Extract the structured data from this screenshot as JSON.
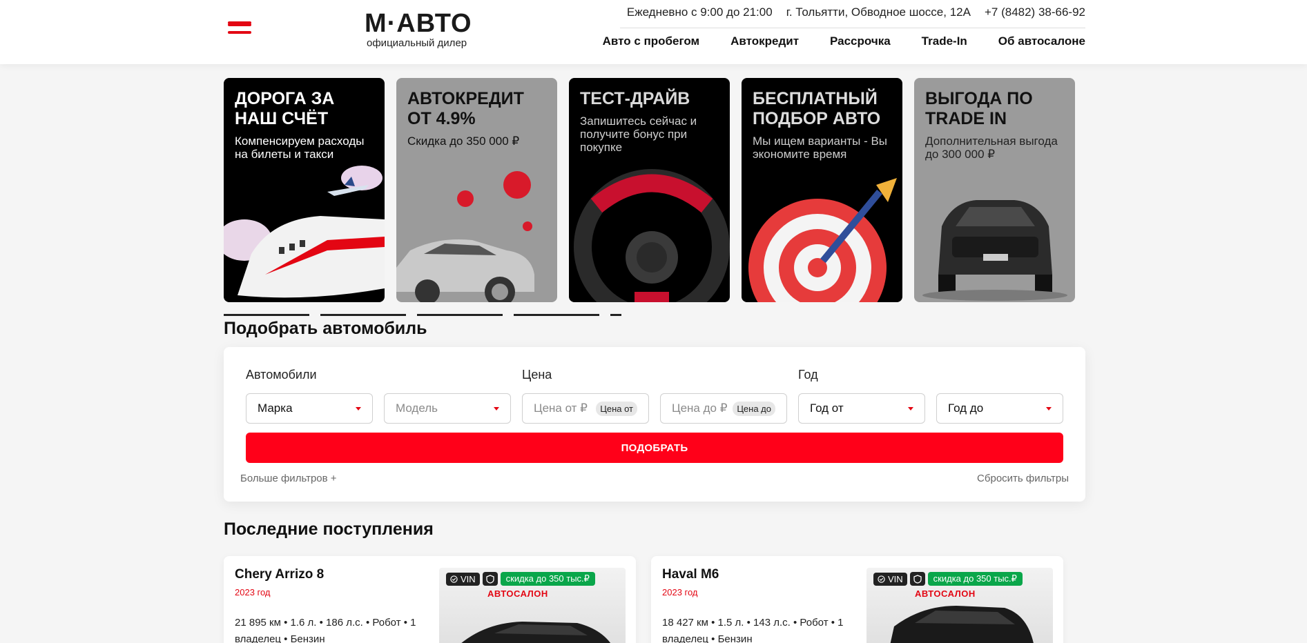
{
  "header": {
    "logo_main": "М·АВТО",
    "logo_sub": "официальный дилер",
    "hours": "Ежедневно с 9:00 до 21:00",
    "address": "г. Тольятти, Обводное шоссе, 12А",
    "phone": "+7 (8482) 38-66-92",
    "nav": [
      "Авто с пробегом",
      "Автокредит",
      "Рассрочка",
      "Trade-In",
      "Об автосалоне"
    ]
  },
  "banners": [
    {
      "title": "ДОРОГА ЗА НАШ СЧЁТ",
      "text": "Компенсируем расходы на билеты и такси",
      "art": "train-plane"
    },
    {
      "title": "АВТОКРЕДИТ ОТ 4.9%",
      "text": "Скидка до 350 000 ₽",
      "art": "car-coins"
    },
    {
      "title": "ТЕСТ-ДРАЙВ",
      "text": "Запишитесь сейчас и получите бонус при покупке",
      "art": "steering-wheel"
    },
    {
      "title": "БЕСПЛАТНЫЙ ПОДБОР АВТО",
      "text": "Мы ищем варианты - Вы экономите время",
      "art": "target-dart"
    },
    {
      "title": "ВЫГОДА ПО TRADE IN",
      "text": "Дополнительная выгода до 300 000 ₽",
      "art": "car-front"
    }
  ],
  "filter": {
    "title": "Подобрать автомобиль",
    "label_cars": "Автомобили",
    "label_price": "Цена",
    "label_year": "Год",
    "brand": "Марка",
    "model": "Модель",
    "price_from": "Цена от ₽",
    "price_from_chip": "Цена от",
    "price_to": "Цена до ₽",
    "price_to_chip": "Цена до",
    "year_from": "Год от",
    "year_to": "Год до",
    "submit": "ПОДОБРАТЬ",
    "more": "Больше фильтров +",
    "reset": "Сбросить фильтры"
  },
  "latest": {
    "title": "Последние поступления",
    "cards": [
      {
        "name": "Chery Arrizo 8",
        "year": "2023 год",
        "specs": "21 895 км • 1.6 л. • 186 л.с. • Робот • 1 владелец • Бензин",
        "vin": "VIN",
        "sale": "скидка до 350 тыс.₽",
        "dealer": "АВТОСАЛОН"
      },
      {
        "name": "Haval M6",
        "year": "2023 год",
        "specs": "18 427 км • 1.5 л. • 143 л.с. • Робот • 1 владелец • Бензин",
        "vin": "VIN",
        "sale": "скидка до 350 тыс.₽",
        "dealer": "АВТОСАЛОН"
      }
    ]
  }
}
